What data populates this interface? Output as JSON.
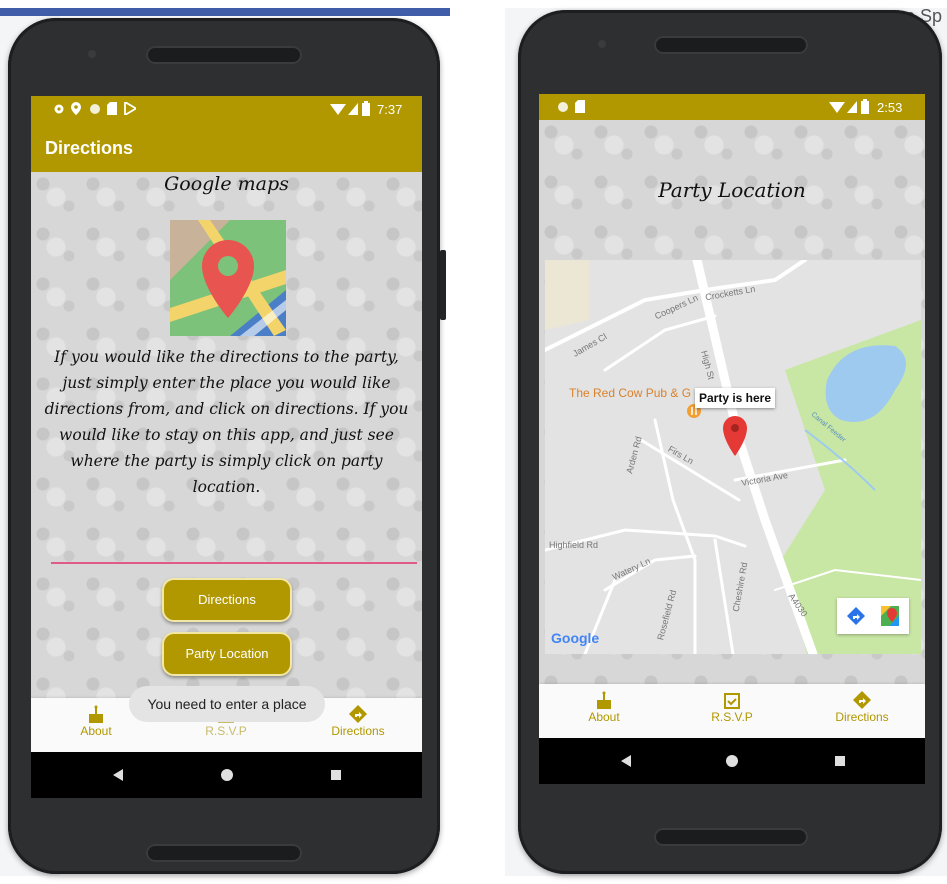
{
  "left_phone": {
    "status": {
      "time": "7:37"
    },
    "appbar_title": "Directions",
    "heading": "Google maps",
    "map_icon": "google-maps-pin-icon",
    "instructions": "If you would like the directions to the party, just simply enter the place you would like directions from, and click on directions. If you would like to stay on this app, and just see where the party is simply click on party location.",
    "place_input": {
      "value": "",
      "placeholder": ""
    },
    "directions_button": "Directions",
    "party_location_button": "Party Location",
    "toast": "You need to enter a place",
    "nav": [
      {
        "label": "About",
        "icon": "cake-icon"
      },
      {
        "label": "R.S.V.P",
        "icon": "calendar-check-icon"
      },
      {
        "label": "Directions",
        "icon": "directions-icon"
      }
    ]
  },
  "right_phone": {
    "status": {
      "time": "2:53"
    },
    "heading": "Party Location",
    "map": {
      "marker_label": "Party is here",
      "poi": "The Red Cow Pub & G",
      "streets": [
        "Crocketts Ln",
        "Coopers Ln",
        "James Cl",
        "High St",
        "Arden Rd",
        "Firs Ln",
        "Victoria Ave",
        "Highfield Rd",
        "Watery Ln",
        "Rosefield Rd",
        "Cheshire Rd",
        "A4030",
        "Canal Feeder"
      ],
      "attribution": "Google"
    },
    "nav": [
      {
        "label": "About",
        "icon": "cake-icon"
      },
      {
        "label": "R.S.V.P",
        "icon": "calendar-check-icon"
      },
      {
        "label": "Directions",
        "icon": "directions-icon"
      }
    ]
  },
  "background_fragment": "o Sp",
  "colors": {
    "accent": "#b19800",
    "toast_bg": "#e4e4e4",
    "pin": "#e53935",
    "park": "#c8e6a4",
    "water": "#9ecaf0"
  }
}
